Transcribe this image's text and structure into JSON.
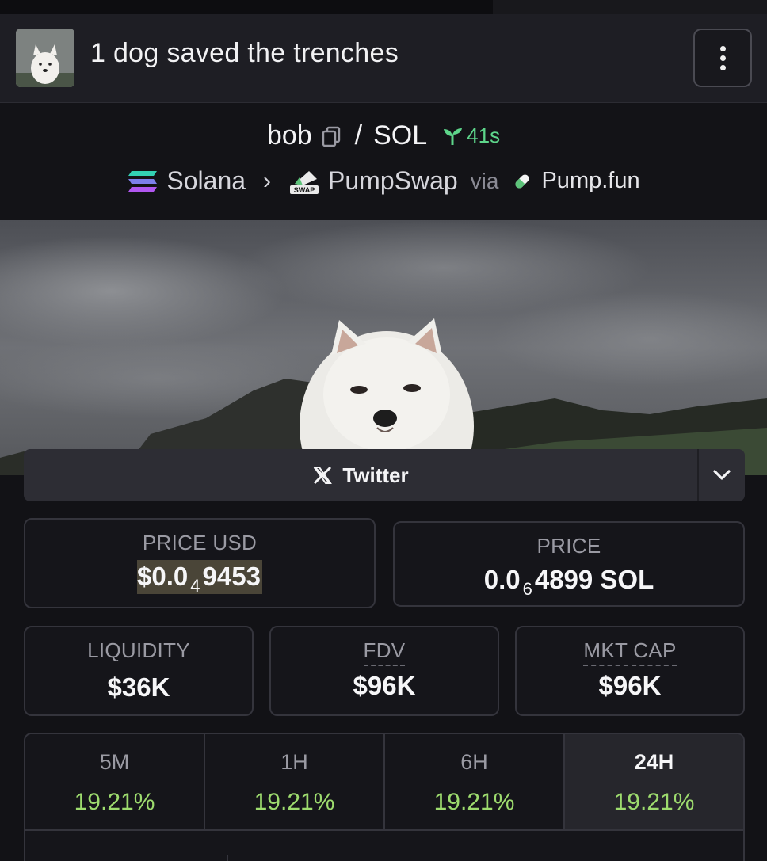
{
  "header": {
    "title": "1 dog saved the trenches",
    "menu_icon": "vertical-ellipsis-icon"
  },
  "pair": {
    "base": "bob",
    "quote": "SOL",
    "separator": "/",
    "age": "41s",
    "chain": "Solana",
    "dex": "PumpSwap",
    "dex_badge": "SWAP",
    "via_label": "via",
    "launchpad": "Pump.fun"
  },
  "social": {
    "twitter_label": "Twitter"
  },
  "stats": {
    "price_usd_label": "PRICE USD",
    "price_usd_prefix": "$0.0",
    "price_usd_zeros": "4",
    "price_usd_digits": "9453",
    "price_label": "PRICE",
    "price_prefix": "0.0",
    "price_zeros": "6",
    "price_digits": "4899 SOL",
    "liquidity_label": "LIQUIDITY",
    "liquidity_value": "$36K",
    "fdv_label": "FDV",
    "fdv_value": "$96K",
    "mktcap_label": "MKT CAP",
    "mktcap_value": "$96K"
  },
  "changes": [
    {
      "period": "5M",
      "value": "19.21%"
    },
    {
      "period": "1H",
      "value": "19.21%"
    },
    {
      "period": "6H",
      "value": "19.21%"
    },
    {
      "period": "24H",
      "value": "19.21%",
      "active": true
    }
  ],
  "colors": {
    "positive": "#9ddb6e",
    "age_green": "#5dd58a",
    "background": "#121216"
  }
}
